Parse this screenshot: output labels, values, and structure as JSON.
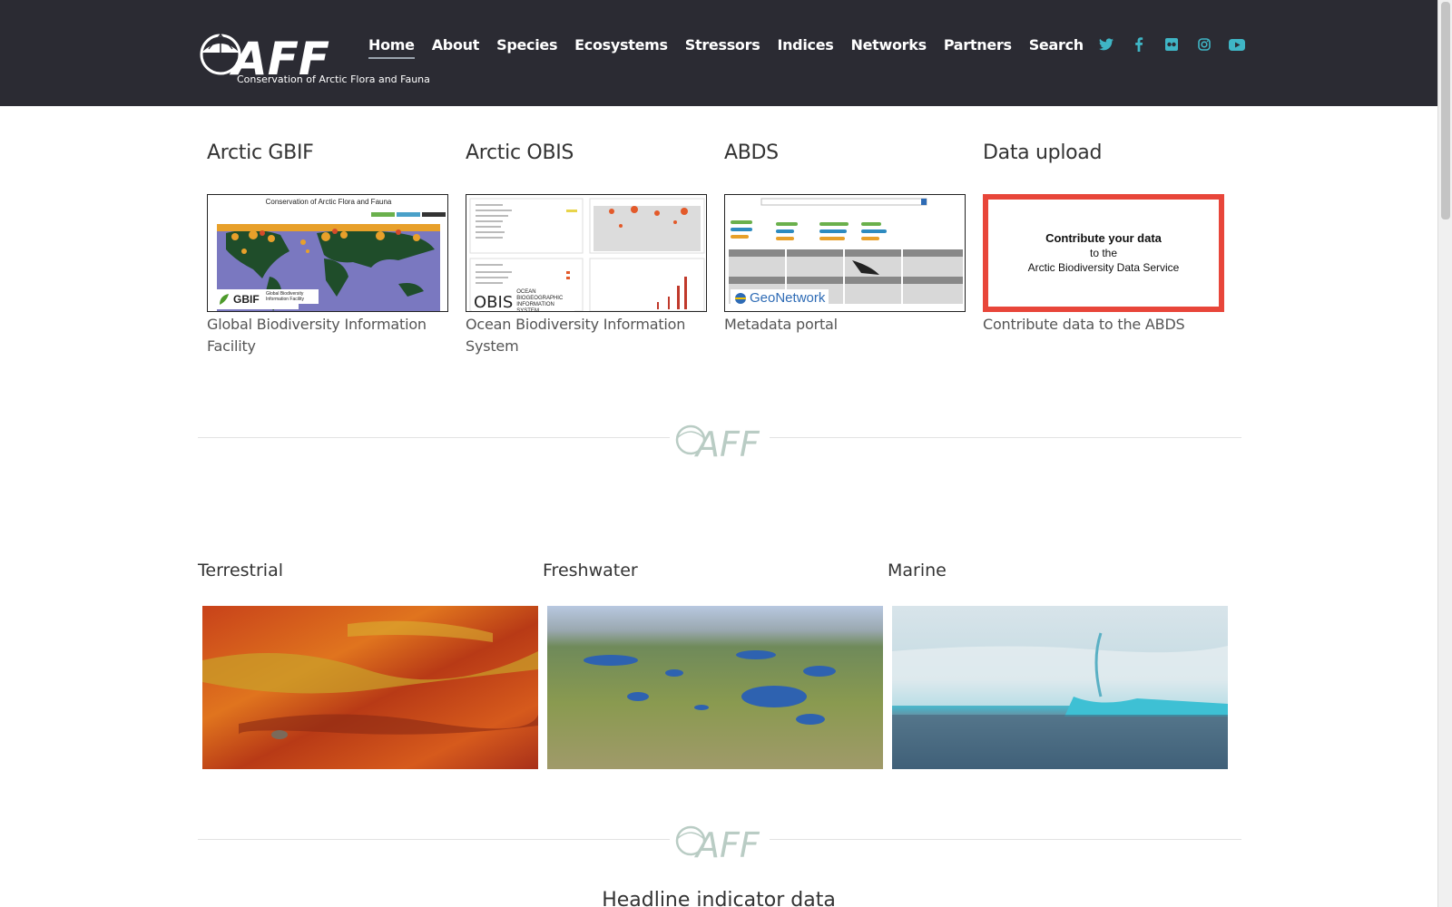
{
  "header": {
    "logo_subtitle": "Conservation of Arctic Flora and Fauna",
    "nav": [
      "Home",
      "About",
      "Species",
      "Ecosystems",
      "Stressors",
      "Indices",
      "Networks",
      "Partners",
      "Search"
    ],
    "social_icons": [
      "twitter-icon",
      "facebook-icon",
      "flickr-icon",
      "instagram-icon",
      "youtube-icon"
    ],
    "accent_color": "#3fb5c5"
  },
  "data_portals": [
    {
      "title": "Arctic GBIF",
      "description": "Global Biodiversity Information Facility",
      "thumb_caption": "Conservation of Arctic Flora and Fauna",
      "brand": "GBIF",
      "brand_sub": "Global Biodiversity Information Facility"
    },
    {
      "title": "Arctic OBIS",
      "description": "Ocean Biodiversity Information System",
      "brand": "OBIS",
      "brand_sub": "OCEAN BIOGEOGRAPHIC INFORMATION SYSTEM"
    },
    {
      "title": "ABDS",
      "description": "Metadata portal",
      "brand": "GeoNetwork"
    },
    {
      "title": "Data upload",
      "description": "Contribute data to the ABDS",
      "box_line1": "Contribute your data",
      "box_line2": "to the",
      "box_line3": "Arctic Biodiversity Data Service",
      "box_color": "#e8463a"
    }
  ],
  "divider_logo": "CAFF",
  "ecosystems": [
    {
      "label": "Terrestrial"
    },
    {
      "label": "Freshwater"
    },
    {
      "label": "Marine"
    }
  ],
  "headline": "Headline indicator data"
}
